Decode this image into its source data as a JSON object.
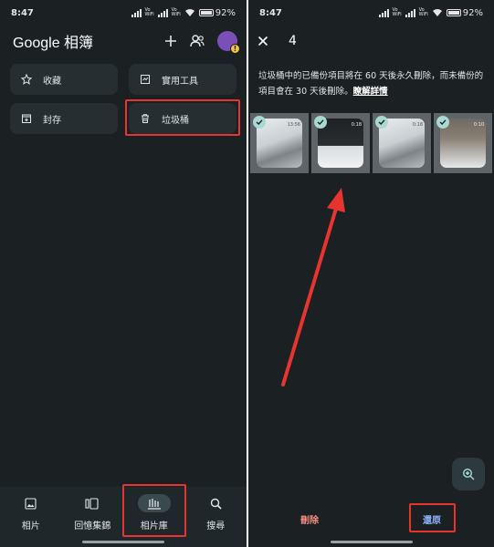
{
  "left": {
    "status": {
      "time": "8:47",
      "volte1": "Vo",
      "wifi_label1": "WiFi",
      "volte2": "Vo",
      "wifi_label2": "WiFi",
      "battery": "92%"
    },
    "app_title": "Google 相簿",
    "cards": {
      "favorites": "收藏",
      "utilities": "實用工具",
      "archive": "封存",
      "trash": "垃圾桶"
    },
    "nav": {
      "photos": "相片",
      "memories": "回憶集錦",
      "library": "相片庫",
      "search": "搜尋"
    },
    "avatar_badge": "!"
  },
  "right": {
    "status": {
      "time": "8:47",
      "volte1": "Vo",
      "wifi_label1": "WiFi",
      "volte2": "Vo",
      "wifi_label2": "WiFi",
      "battery": "92%"
    },
    "selected_count": "4",
    "notice_text": "垃圾桶中的已備份項目將在 60 天後永久刪除，而未備份的項目會在 30 天後刪除。",
    "learn_more": "瞭解詳情",
    "thumbs": [
      {
        "label": "13:56"
      },
      {
        "label": "0:18"
      },
      {
        "label": "0:18"
      },
      {
        "label": "0:10"
      }
    ],
    "actions": {
      "delete": "刪除",
      "restore": "還原"
    }
  },
  "colors": {
    "background": "#1b2023",
    "card": "#262e31",
    "accent": "#a8d9d3",
    "highlight": "#e8342f",
    "delete": "#f28b82",
    "restore": "#8ab4f8"
  }
}
